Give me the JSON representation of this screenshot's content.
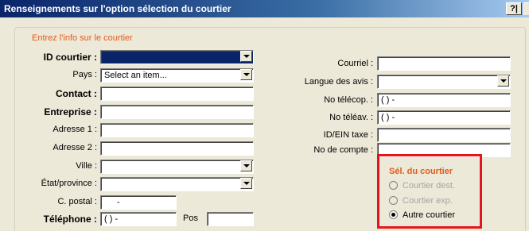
{
  "window": {
    "title": "Renseignements sur l'option sélection du courtier",
    "help_label": "?|"
  },
  "form": {
    "caption": "Entrez l'info sur le courtier",
    "left": {
      "id_courtier": {
        "label": "ID courtier :",
        "value": ""
      },
      "pays": {
        "label": "Pays :",
        "value": "Select an item..."
      },
      "contact": {
        "label": "Contact :",
        "value": ""
      },
      "entreprise": {
        "label": "Entreprise :",
        "value": ""
      },
      "adresse1": {
        "label": "Adresse 1 :",
        "value": ""
      },
      "adresse2": {
        "label": "Adresse 2 :",
        "value": ""
      },
      "ville": {
        "label": "Ville :",
        "value": ""
      },
      "etat": {
        "label": "État/province :",
        "value": ""
      },
      "code_postal": {
        "label": "C. postal :",
        "value": "-"
      },
      "telephone": {
        "label": "Téléphone :",
        "value": "( )  -"
      },
      "poste": {
        "label": "Pos",
        "value": ""
      }
    },
    "right": {
      "courriel": {
        "label": "Courriel :",
        "value": ""
      },
      "langue": {
        "label": "Langue des avis :",
        "value": ""
      },
      "telecop": {
        "label": "No télécop. :",
        "value": "( )  -"
      },
      "teleav": {
        "label": "No téléav. :",
        "value": "( )  -"
      },
      "id_ein": {
        "label": "ID/EIN taxe :",
        "value": ""
      },
      "compte": {
        "label": "No de compte :",
        "value": ""
      }
    },
    "courier_selection": {
      "caption": "Sél. du courtier",
      "options": [
        {
          "label": "Courtier dest.",
          "selected": false,
          "enabled": false
        },
        {
          "label": "Courtier exp.",
          "selected": false,
          "enabled": false
        },
        {
          "label": "Autre courtier",
          "selected": true,
          "enabled": true
        }
      ]
    }
  },
  "colors": {
    "title_bar": "#0a246a",
    "caption_orange": "#e35a1c",
    "highlight_frame": "#e3161e",
    "dialog_bg": "#ece9d8"
  }
}
